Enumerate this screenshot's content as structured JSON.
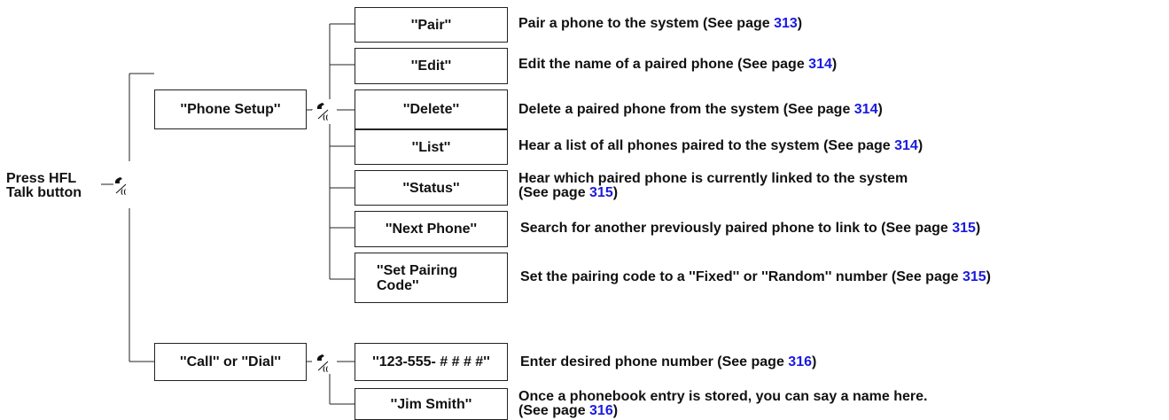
{
  "root": {
    "line1": "Press HFL",
    "line2": "Talk button"
  },
  "branches": [
    {
      "label": "''Phone Setup''"
    },
    {
      "label": "''Call'' or ''Dial''"
    }
  ],
  "setup_items": [
    {
      "label": "''Pair''",
      "desc_pre": "Pair a phone to the system (See page ",
      "page": "313",
      "desc_post": ")"
    },
    {
      "label": "''Edit''",
      "desc_pre": "Edit the name of a paired phone (See page ",
      "page": "314",
      "desc_post": ")"
    },
    {
      "label": "''Delete''",
      "desc_pre": "Delete a paired phone from the system (See page ",
      "page": "314",
      "desc_post": ")"
    },
    {
      "label": "''List''",
      "desc_pre": "Hear a list of all phones paired to the system (See page ",
      "page": "314",
      "desc_post": ")"
    },
    {
      "label": "''Status''",
      "desc_line1": "Hear which paired phone is currently linked to the system",
      "desc_pre": "(See page ",
      "page": "315",
      "desc_post": ")"
    },
    {
      "label": "''Next Phone''",
      "desc_pre": "Search for another previously paired phone to link to (See page ",
      "page": "315",
      "desc_post": ")"
    },
    {
      "label_line1": "''Set Pairing",
      "label_line2": "Code''",
      "desc_pre": "Set the pairing code to a ''Fixed'' or ''Random'' number (See page ",
      "page": "315",
      "desc_post": ")"
    }
  ],
  "call_items": [
    {
      "label": "''123-555- # # # #''",
      "desc_pre": "Enter desired phone number (See page ",
      "page": "316",
      "desc_post": ")"
    },
    {
      "label": "''Jim Smith''",
      "desc_line1": "Once a phonebook entry is stored, you can say a name here.",
      "desc_pre": "(See page ",
      "page": "316",
      "desc_post": ")"
    }
  ],
  "icons": [
    "talk-button-icon",
    "talk-button-icon",
    "talk-button-icon"
  ],
  "colors": {
    "page_link": "#1a1ae0",
    "line": "#222222"
  }
}
